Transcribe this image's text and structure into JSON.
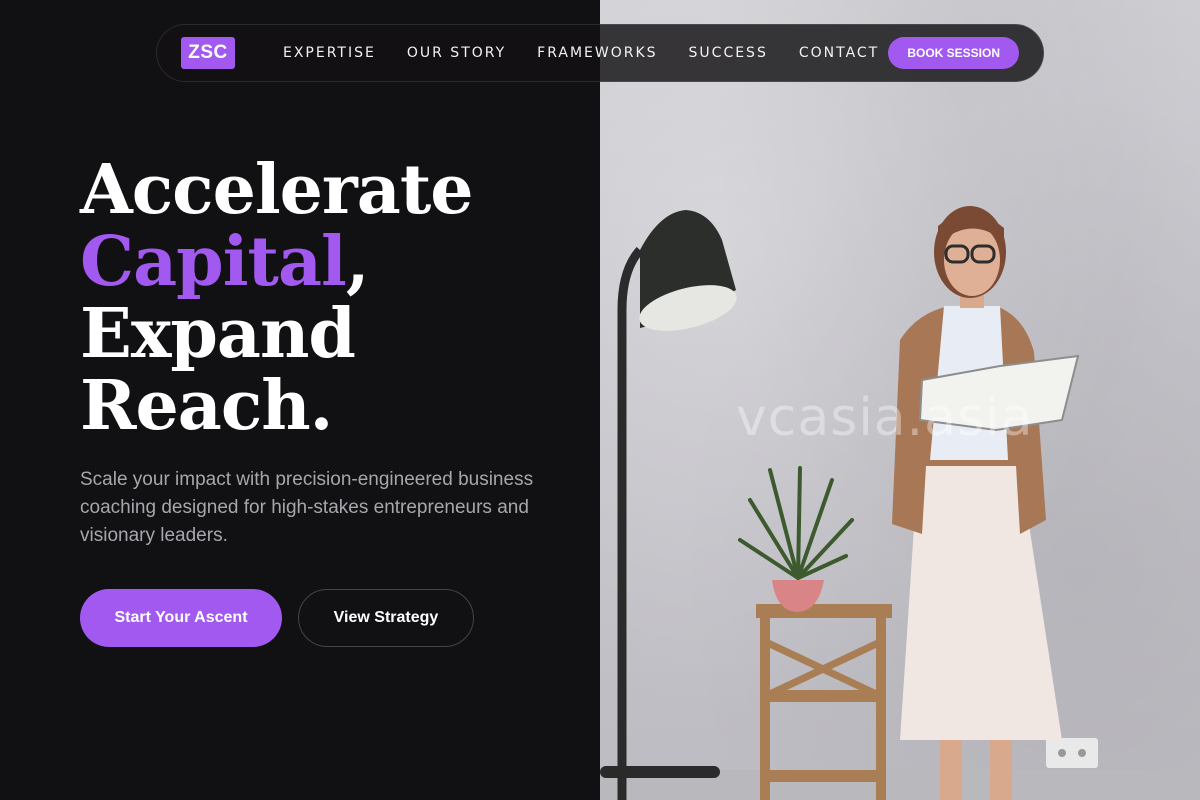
{
  "brand": {
    "logo_text": "ZSC",
    "accent_color": "#a259f0"
  },
  "nav": {
    "links": [
      {
        "label": "EXPERTISE"
      },
      {
        "label": "OUR STORY"
      },
      {
        "label": "FRAMEWORKS"
      },
      {
        "label": "SUCCESS"
      },
      {
        "label": "CONTACT"
      }
    ],
    "cta_label": "BOOK SESSION"
  },
  "hero": {
    "headline": {
      "line1": "Accelerate",
      "line2_accent": "Capital",
      "line2_suffix": ",",
      "line3": "Expand",
      "line4": "Reach."
    },
    "subtext": "Scale your impact with precision-engineered business coaching designed for high-stakes entrepreneurs and visionary leaders.",
    "primary_cta": "Start Your Ascent",
    "secondary_cta": "View Strategy"
  },
  "photo": {
    "watermark": "vcasia.asia"
  }
}
